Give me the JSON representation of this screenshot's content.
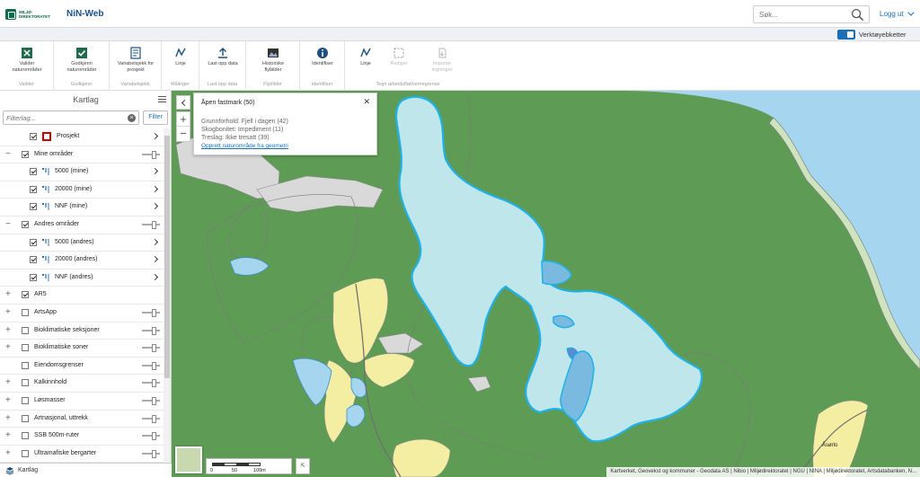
{
  "header": {
    "logo_text_line1": "MILJØ-",
    "logo_text_line2": "DIREKTORATET",
    "app_title": "NiN-Web",
    "search_placeholder": "Søk...",
    "logout_label": "Logg ut"
  },
  "toolstrip": {
    "toggle_label": "Verktøyebketter",
    "toggle_on": true
  },
  "ribbon": {
    "groups": [
      {
        "label": "Valider",
        "buttons": [
          {
            "label": "Valider naturområder",
            "icon": "validate-icon"
          }
        ]
      },
      {
        "label": "Godkjenn",
        "buttons": [
          {
            "label": "Godkjenn naturområder",
            "icon": "approve-icon"
          }
        ]
      },
      {
        "label": "Variabelsjekk",
        "buttons": [
          {
            "label": "Variabelsjekk for prosjekt",
            "icon": "checklist-icon"
          }
        ]
      },
      {
        "label": "Målinger",
        "buttons": [
          {
            "label": "Linje",
            "icon": "measure-line-icon"
          }
        ]
      },
      {
        "label": "Last opp data",
        "buttons": [
          {
            "label": "Last opp data",
            "icon": "upload-icon"
          }
        ]
      },
      {
        "label": "Flybilder",
        "buttons": [
          {
            "label": "Historiske flybilder",
            "icon": "photo-icon"
          }
        ]
      },
      {
        "label": "Identifiser",
        "buttons": [
          {
            "label": "Identifiser",
            "icon": "info-icon"
          }
        ]
      },
      {
        "label": "Tegn arbeidsflat/vernegrense",
        "buttons": [
          {
            "label": "Linje",
            "icon": "draw-line-icon"
          },
          {
            "label": "Rediger",
            "icon": "edit-select-icon"
          },
          {
            "label": "Importer tegninger",
            "icon": "import-icon"
          }
        ]
      }
    ]
  },
  "layers_panel": {
    "title": "Kartlag",
    "filter_placeholder": "Filterlag...",
    "filter_button": "Filter",
    "footer_label": "Kartlag",
    "items": [
      {
        "label": "Prosjekt",
        "checked": true,
        "expand": "",
        "indent": 1,
        "legend": "red-square",
        "control": "chevron"
      },
      {
        "label": "Mine områder",
        "checked": true,
        "expand": "−",
        "indent": 0,
        "legend": "",
        "control": "slider"
      },
      {
        "label": "5000 (mine)",
        "checked": true,
        "expand": "",
        "indent": 1,
        "legend": "bars",
        "control": "chevron"
      },
      {
        "label": "20000 (mine)",
        "checked": true,
        "expand": "",
        "indent": 1,
        "legend": "bars",
        "control": "chevron"
      },
      {
        "label": "NNF (mine)",
        "checked": true,
        "expand": "",
        "indent": 1,
        "legend": "bars",
        "control": "chevron"
      },
      {
        "label": "Andres områder",
        "checked": true,
        "expand": "−",
        "indent": 0,
        "legend": "",
        "control": "slider"
      },
      {
        "label": "5000 (andres)",
        "checked": true,
        "expand": "",
        "indent": 1,
        "legend": "bars",
        "control": "chevron"
      },
      {
        "label": "20000 (andres)",
        "checked": true,
        "expand": "",
        "indent": 1,
        "legend": "bars",
        "control": "chevron"
      },
      {
        "label": "NNF (andres)",
        "checked": true,
        "expand": "",
        "indent": 1,
        "legend": "bars",
        "control": "chevron"
      },
      {
        "label": "AR5",
        "checked": true,
        "expand": "+",
        "indent": 0,
        "legend": "",
        "control": "none"
      },
      {
        "label": "ArtsApp",
        "checked": false,
        "expand": "+",
        "indent": 0,
        "legend": "",
        "control": "slider"
      },
      {
        "label": "Bioklimatiske seksjoner",
        "checked": false,
        "expand": "+",
        "indent": 0,
        "legend": "",
        "control": "slider"
      },
      {
        "label": "Bioklimatiske soner",
        "checked": false,
        "expand": "+",
        "indent": 0,
        "legend": "",
        "control": "slider"
      },
      {
        "label": "Eiendomsgrenser",
        "checked": false,
        "expand": "",
        "indent": 0,
        "legend": "",
        "control": "slider"
      },
      {
        "label": "Kalkinnhold",
        "checked": false,
        "expand": "+",
        "indent": 0,
        "legend": "",
        "control": "slider"
      },
      {
        "label": "Løsmasser",
        "checked": false,
        "expand": "+",
        "indent": 0,
        "legend": "",
        "control": "slider"
      },
      {
        "label": "Artnasjonal, uttrekk",
        "checked": false,
        "expand": "+",
        "indent": 0,
        "legend": "",
        "control": "slider"
      },
      {
        "label": "SSB 500m-ruter",
        "checked": false,
        "expand": "+",
        "indent": 0,
        "legend": "",
        "control": "slider"
      },
      {
        "label": "Ultramafiske bergarter",
        "checked": false,
        "expand": "+",
        "indent": 0,
        "legend": "",
        "control": "slider"
      }
    ]
  },
  "map": {
    "popup": {
      "title": "Åpen fastmark (50)",
      "lines": [
        "Grunnforhold: Fjell i dagen (42)",
        "Skogbonitet: Impediment (11)",
        "Treslag: Ikke tresatt (39)"
      ],
      "link": "Opprett naturområde fra geometri"
    },
    "scale_labels": [
      "0",
      "50",
      "100m"
    ],
    "place_label": "Åsørlo",
    "attribution": "Kartverket, Geovekst og kommuner - Geodata AS | Nibio | Miljødirektoratet | NGU | NINA | Miljødirektoratet, Artsdatabanken, N...",
    "colors": {
      "forest": "#5e9c55",
      "water": "#a5d5ef",
      "open_land": "#d9d9d9",
      "selected_fill": "#bfe6ea",
      "selected_outline": "#1fb2e8",
      "marsh": "#f3eea2"
    }
  }
}
